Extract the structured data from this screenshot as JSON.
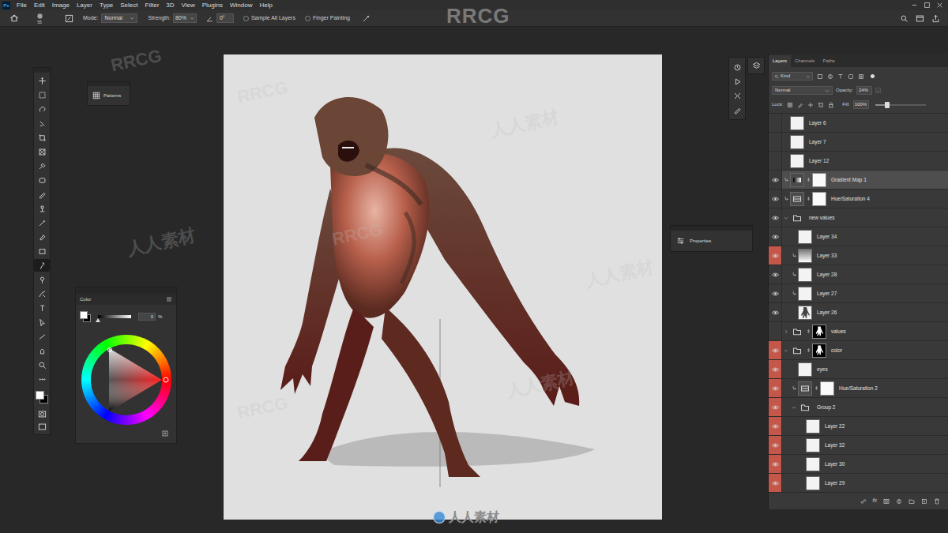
{
  "app": {
    "logo": "Ps"
  },
  "menu": [
    "File",
    "Edit",
    "Image",
    "Layer",
    "Type",
    "Select",
    "Filter",
    "3D",
    "View",
    "Plugins",
    "Window",
    "Help"
  ],
  "options": {
    "brush_size": "55",
    "mode_label": "Mode:",
    "mode": "Normal",
    "strength_label": "Strength:",
    "strength": "80%",
    "angle": "0°",
    "sample_all_layers": {
      "label": "Sample All Layers",
      "checked": false
    },
    "finger_painting": {
      "label": "Finger Painting",
      "checked": false
    }
  },
  "tools": [
    {
      "selected": false
    },
    {
      "selected": false
    },
    {
      "selected": false
    },
    {
      "selected": false
    },
    {
      "selected": false
    },
    {
      "selected": false
    },
    {
      "selected": false
    },
    {
      "selected": false
    },
    {
      "selected": false
    },
    {
      "selected": false
    },
    {
      "selected": false
    },
    {
      "selected": false
    },
    {
      "selected": false
    },
    {
      "selected": true
    },
    {
      "selected": false
    },
    {
      "selected": false
    },
    {
      "selected": false
    },
    {
      "selected": false
    },
    {
      "selected": false
    },
    {
      "selected": false
    },
    {
      "selected": false
    },
    {
      "selected": false
    }
  ],
  "swatches": {
    "foreground": "#ffffff",
    "background": "#000000"
  },
  "patterns_panel": {
    "title": "Patterns"
  },
  "properties_panel": {
    "title": "Properties"
  },
  "color_panel": {
    "title": "Color",
    "value": "0",
    "unit": "%",
    "level": 0,
    "foreground": "#ffffff",
    "background": "#000000"
  },
  "layers_panel": {
    "tabs": [
      {
        "label": "Layers",
        "selected": true
      },
      {
        "label": "Channels",
        "selected": false
      },
      {
        "label": "Paths",
        "selected": false
      }
    ],
    "filter": "Kind",
    "blend_mode": "Normal",
    "opacity_label": "Opacity:",
    "opacity": "24%",
    "opacity_slider_level": 0.24,
    "lock_label": "Lock:",
    "fill_label": "Fill:",
    "fill": "100%",
    "layers": [
      {
        "name": "Layer 6",
        "kind": "layer",
        "visible": false,
        "selected": false,
        "clipped": false,
        "has_mask": false,
        "expanded": false,
        "depth": 0,
        "color": "#393939"
      },
      {
        "name": "Layer 7",
        "kind": "layer",
        "visible": false,
        "selected": false,
        "clipped": false,
        "has_mask": false,
        "expanded": false,
        "depth": 0,
        "color": "#393939"
      },
      {
        "name": "Layer 12",
        "kind": "layer",
        "visible": false,
        "selected": false,
        "clipped": false,
        "has_mask": false,
        "expanded": false,
        "depth": 0,
        "color": "#393939"
      },
      {
        "name": "Gradient Map 1",
        "kind": "gradient",
        "visible": true,
        "selected": true,
        "clipped": true,
        "has_mask": true,
        "expanded": false,
        "depth": 0,
        "color": "#393939"
      },
      {
        "name": "Hue/Saturation 4",
        "kind": "huesat",
        "visible": true,
        "selected": false,
        "clipped": true,
        "has_mask": true,
        "expanded": false,
        "depth": 0,
        "color": "#393939"
      },
      {
        "name": "new values",
        "kind": "group",
        "visible": true,
        "selected": false,
        "clipped": false,
        "has_mask": false,
        "expanded": true,
        "depth": 0,
        "color": "#393939"
      },
      {
        "name": "Layer 34",
        "kind": "layer",
        "visible": true,
        "selected": false,
        "clipped": false,
        "has_mask": false,
        "expanded": false,
        "depth": 1,
        "color": "#393939"
      },
      {
        "name": "Layer 33",
        "kind": "gradientlayer",
        "visible": true,
        "selected": false,
        "clipped": true,
        "has_mask": false,
        "expanded": false,
        "depth": 1,
        "color": "#c4574a"
      },
      {
        "name": "Layer 28",
        "kind": "layer",
        "visible": true,
        "selected": false,
        "clipped": true,
        "has_mask": false,
        "expanded": false,
        "depth": 1,
        "color": "#393939"
      },
      {
        "name": "Layer 27",
        "kind": "layer",
        "visible": true,
        "selected": false,
        "clipped": true,
        "has_mask": false,
        "expanded": false,
        "depth": 1,
        "color": "#393939"
      },
      {
        "name": "Layer 26",
        "kind": "figure",
        "visible": true,
        "selected": false,
        "clipped": false,
        "has_mask": false,
        "expanded": false,
        "depth": 1,
        "color": "#393939"
      },
      {
        "name": "values",
        "kind": "group",
        "visible": false,
        "selected": false,
        "clipped": false,
        "has_mask": true,
        "expanded": false,
        "depth": 0,
        "color": "#393939"
      },
      {
        "name": "color",
        "kind": "group",
        "visible": true,
        "selected": false,
        "clipped": false,
        "has_mask": true,
        "expanded": true,
        "depth": 0,
        "color": "#c4574a"
      },
      {
        "name": "eyes",
        "kind": "layer",
        "visible": true,
        "selected": false,
        "clipped": false,
        "has_mask": false,
        "expanded": false,
        "depth": 1,
        "color": "#c4574a"
      },
      {
        "name": "Hue/Saturation 2",
        "kind": "huesat",
        "visible": true,
        "selected": false,
        "clipped": true,
        "has_mask": true,
        "expanded": false,
        "depth": 1,
        "color": "#c4574a"
      },
      {
        "name": "Group 2",
        "kind": "group",
        "visible": true,
        "selected": false,
        "clipped": false,
        "has_mask": false,
        "expanded": true,
        "depth": 1,
        "color": "#c4574a"
      },
      {
        "name": "Layer 22",
        "kind": "layer",
        "visible": true,
        "selected": false,
        "clipped": false,
        "has_mask": false,
        "expanded": false,
        "depth": 2,
        "color": "#c4574a"
      },
      {
        "name": "Layer 32",
        "kind": "layer",
        "visible": true,
        "selected": false,
        "clipped": false,
        "has_mask": false,
        "expanded": false,
        "depth": 2,
        "color": "#c4574a"
      },
      {
        "name": "Layer 30",
        "kind": "layer",
        "visible": true,
        "selected": false,
        "clipped": false,
        "has_mask": false,
        "expanded": false,
        "depth": 2,
        "color": "#c4574a"
      },
      {
        "name": "Layer 29",
        "kind": "layer",
        "visible": true,
        "selected": false,
        "clipped": false,
        "has_mask": false,
        "expanded": false,
        "depth": 2,
        "color": "#c4574a"
      }
    ],
    "footer_fx": "fx"
  },
  "watermark": {
    "brand": "RRCG",
    "site": "人人素材"
  }
}
